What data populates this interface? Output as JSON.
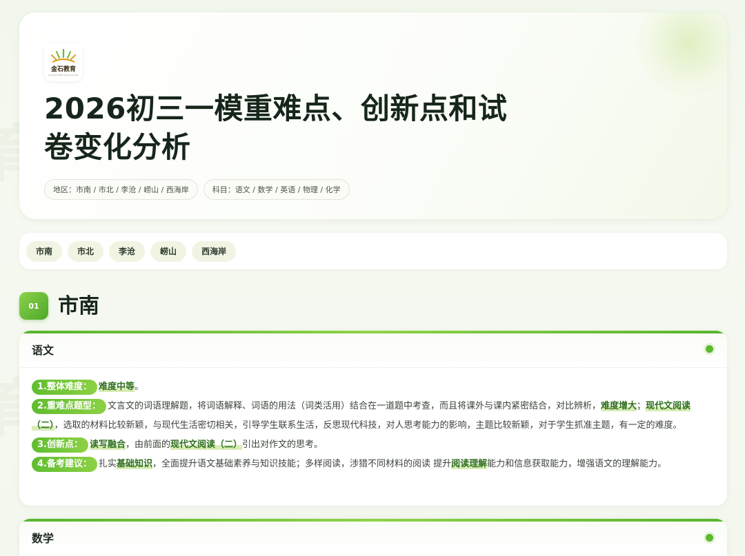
{
  "header": {
    "logo_name": "金石教育",
    "logo_sub": "GOLDSTONE EDUCATION",
    "title_line1": "2026初三一模重难点、创新点和试",
    "title_line2": "卷变化分析",
    "region_chip": "地区：市南 / 市北 / 李沧 / 崂山 / 西海岸",
    "subject_chip": "科目：语文 / 数学 / 英语 / 物理 / 化学"
  },
  "tabs": [
    "市南",
    "市北",
    "李沧",
    "崂山",
    "西海岸"
  ],
  "section": {
    "number": "01",
    "title": "市南"
  },
  "chinese": {
    "name": "语文",
    "item1": {
      "label": "1.整体难度：",
      "hl1": "难度中等",
      "t1": "。"
    },
    "item2": {
      "label": "2.重难点题型：",
      "t1": "文言文的词语理解题，将词语解释、词语的用法（词类活用）结合在一道题中考查，而且将课外与课内紧密结合，对比辨析，",
      "hl1": "难度增大",
      "t2": "；",
      "hl2": "现代文阅读（二）",
      "t3": "，选取的材料比较新颖，与现代生活密切相关，引导学生联系生活，反思现代科技，对人思考能力的影响，主题比较新颖，对于学生抓准主题，有一定的难度。"
    },
    "item3": {
      "label": "3.创新点：",
      "hl1": "读写融合",
      "t1": "，由前面的",
      "hl2": "现代文阅读（二）",
      "t2": "引出对作文的思考。"
    },
    "item4": {
      "label": "4.备考建议：",
      "t1": "扎实",
      "hl1": "基础知识",
      "t2": "，全面提升语文基础素养与知识技能；多样阅读，涉猎不同材料的阅读  提升",
      "hl2": "阅读理解",
      "t3": "能力和信息获取能力，增强语文的理解能力。"
    }
  },
  "math": {
    "name": "数学"
  },
  "colors": {
    "accent": "#5cb82f",
    "highlight_text": "#2f6e1e"
  }
}
